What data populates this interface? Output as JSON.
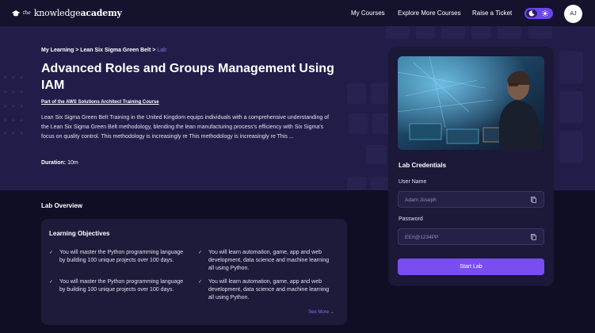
{
  "nav": {
    "logo": {
      "prefix": "the",
      "word1": "knowledge",
      "word2": "academy"
    },
    "links": [
      "My Courses",
      "Explore More Courses",
      "Raise a Ticket"
    ],
    "avatar_initials": "AJ"
  },
  "hero": {
    "breadcrumb": [
      "My Learning",
      ">",
      "Lean Six Sigma Green Belt",
      ">",
      "Lab"
    ],
    "title": "Advanced Roles and Groups Management Using IAM",
    "subtitle": "Part of the AWS Solutions Architect Training Course",
    "description": "Lean Six Sigma Green Belt Training in the United Kingdom equips individuals with a comprehensive understanding of the Lean Six Sigma Green Belt methodology, blending the lean manufacturing process's efficiency with Six Sigma's focus on quality control. This methodology is increasingly re  This methodology is increasingly re This ...",
    "duration_label": "Duration:",
    "duration_value": "10m"
  },
  "overview": {
    "title": "Lab Overview",
    "objectives_title": "Learning Objectives",
    "objectives": [
      "You will master the Python programming language by building 100 unique projects over 100 days.",
      "You will learn automation, game, app and web development, data science and machine learning all using Python.",
      "You will master the Python programming language by building 100 unique projects over 100 days.",
      "You will learn automation, game, app and web development, data science and machine learning all using Python."
    ],
    "see_more": "See More"
  },
  "lab": {
    "credentials_title": "Lab Credentials",
    "username_label": "User Name",
    "username_value": "Adam Joseph",
    "password_label": "Password",
    "password_value": "EErt@1234PP",
    "start_button": "Start Lab"
  },
  "colors": {
    "accent": "#7a4df0",
    "hero_bg": "#221d48",
    "page_bg": "#100e24",
    "card_bg": "#1b1838"
  }
}
